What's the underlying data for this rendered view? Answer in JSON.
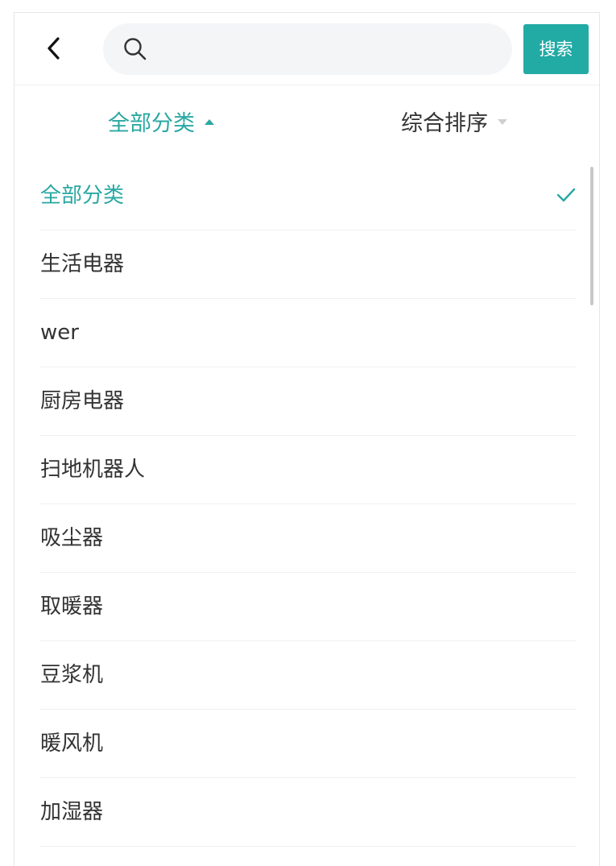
{
  "header": {
    "back_label": "返回",
    "search_placeholder": "",
    "search_value": "",
    "search_button_label": "搜索"
  },
  "filters": {
    "category_label": "全部分类",
    "sort_label": "综合排序"
  },
  "categories": [
    {
      "label": "全部分类",
      "selected": true
    },
    {
      "label": "生活电器",
      "selected": false
    },
    {
      "label": "wer",
      "selected": false
    },
    {
      "label": "厨房电器",
      "selected": false
    },
    {
      "label": "扫地机器人",
      "selected": false
    },
    {
      "label": "吸尘器",
      "selected": false
    },
    {
      "label": "取暖器",
      "selected": false
    },
    {
      "label": "豆浆机",
      "selected": false
    },
    {
      "label": "暖风机",
      "selected": false
    },
    {
      "label": "加湿器",
      "selected": false
    }
  ],
  "colors": {
    "accent": "#2aa8a2",
    "button_bg": "#22aaa5",
    "text": "#333333",
    "divider": "#f0f0f0"
  },
  "icons": {
    "back": "chevron-left-icon",
    "search": "search-icon",
    "check": "check-icon",
    "sort_up": "caret-up-icon",
    "sort_down": "caret-down-icon"
  }
}
